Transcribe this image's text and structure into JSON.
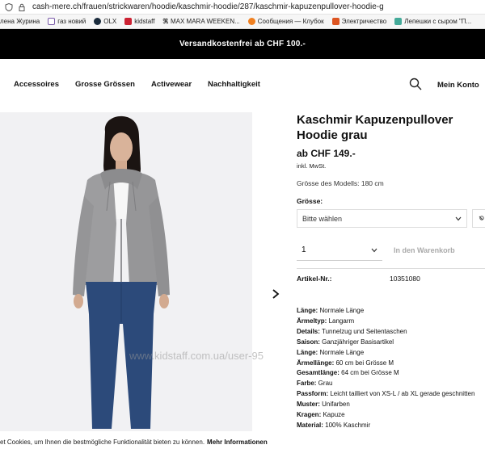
{
  "browser": {
    "url": "cash-mere.ch/frauen/strickwaren/hoodie/kaschmir-hoodie/287/kaschmir-kapuzenpullover-hoodie-g",
    "bookmarks": [
      {
        "label": "лена Журина",
        "color": ""
      },
      {
        "label": "газ новий",
        "color": "#7a5aa8"
      },
      {
        "label": "OLX",
        "color": "#1a2b3c"
      },
      {
        "label": "kidstaff",
        "color": "#c23"
      },
      {
        "label": "MAX MARA WEEKEN...",
        "color": "#222"
      },
      {
        "label": "Сообщения — Клубок",
        "color": "#f08020"
      },
      {
        "label": "Электричество",
        "color": "#d52"
      },
      {
        "label": "Лепешки с сыром \"П...",
        "color": "#4a9"
      }
    ]
  },
  "promo": "Versandkostenfrei ab CHF 100.-",
  "nav": {
    "items": [
      "Accessoires",
      "Grosse Grössen",
      "Activewear",
      "Nachhaltigkeit"
    ],
    "account": "Mein Konto"
  },
  "product": {
    "title": "Kaschmir Kapuzenpullover Hoodie grau",
    "price": "ab CHF 149.-",
    "tax": "inkl. MwSt.",
    "model_size": "Grösse des Modells: 180 cm",
    "size_label": "Grösse:",
    "size_placeholder": "Bitte wählen",
    "quantity": "1",
    "cart_button": "In den Warenkorb",
    "artnr_label": "Artikel-Nr.:",
    "artnr_value": "10351080",
    "specs": [
      {
        "label": "Länge:",
        "value": " Normale Länge"
      },
      {
        "label": "Ärmeltyp:",
        "value": " Langarm"
      },
      {
        "label": "Details:",
        "value": " Tunnelzug und Seitentaschen"
      },
      {
        "label": "Saison:",
        "value": " Ganzjähriger Basisartikel"
      },
      {
        "label": "Länge:",
        "value": " Normale Länge"
      },
      {
        "label": "Ärmellänge:",
        "value": " 60 cm bei Grösse M"
      },
      {
        "label": "Gesamtlänge:",
        "value": " 64 cm bei Grösse M"
      },
      {
        "label": "Farbe:",
        "value": " Grau"
      },
      {
        "label": "Passform:",
        "value": " Leicht tailliert von XS-L / ab XL gerade geschnitten"
      },
      {
        "label": "Muster:",
        "value": " Unifarben"
      },
      {
        "label": "Kragen:",
        "value": " Kapuze"
      },
      {
        "label": "Material:",
        "value": " 100% Kaschmir"
      }
    ]
  },
  "watermark": "www.kidstaff.com.ua/user-95",
  "cookie": {
    "text": "et Cookies, um Ihnen die bestmögliche Funktionalität bieten zu können.",
    "link": "Mehr Informationen"
  },
  "colors": {
    "promo_bg": "#000000",
    "sweater": "#9a9a9c",
    "jeans": "#2c4a7a"
  }
}
